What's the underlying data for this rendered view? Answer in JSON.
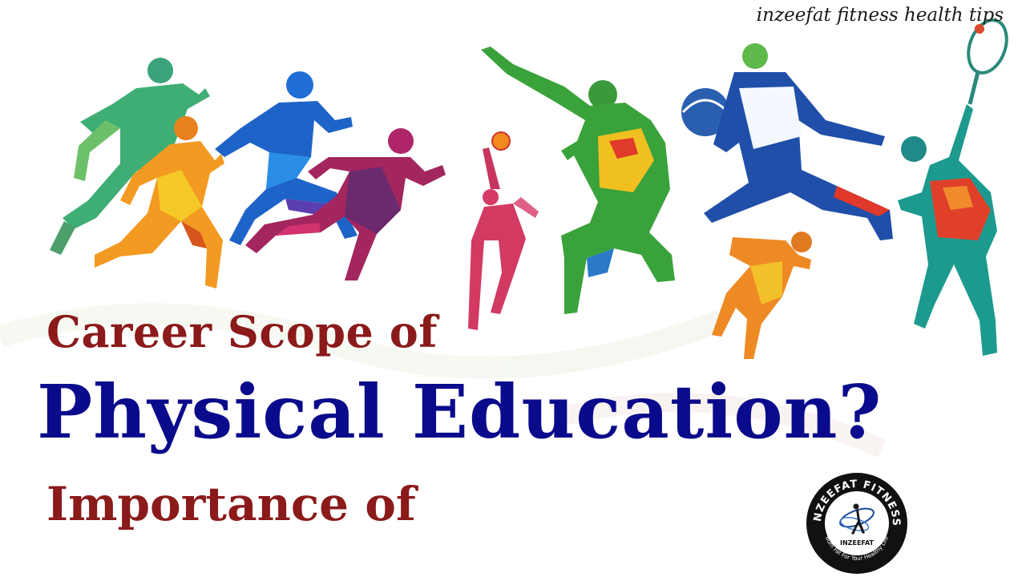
{
  "watermark": "inzeefat fitness health tips",
  "headline": {
    "line1": "Career Scope of",
    "line2": "Physical Education?",
    "line3": "Importance of"
  },
  "logo": {
    "ring_text": "INZEEFAT FITNESS",
    "center_text": "INZEEFAT",
    "tagline": "Burn Fat For Your Healthy Life"
  },
  "colors": {
    "accent_red": "#8b1a1a",
    "accent_blue": "#0a0a8c"
  },
  "icons": [
    "runner-icon",
    "volleyball-player-icon",
    "basketball-player-icon",
    "tennis-player-icon"
  ]
}
